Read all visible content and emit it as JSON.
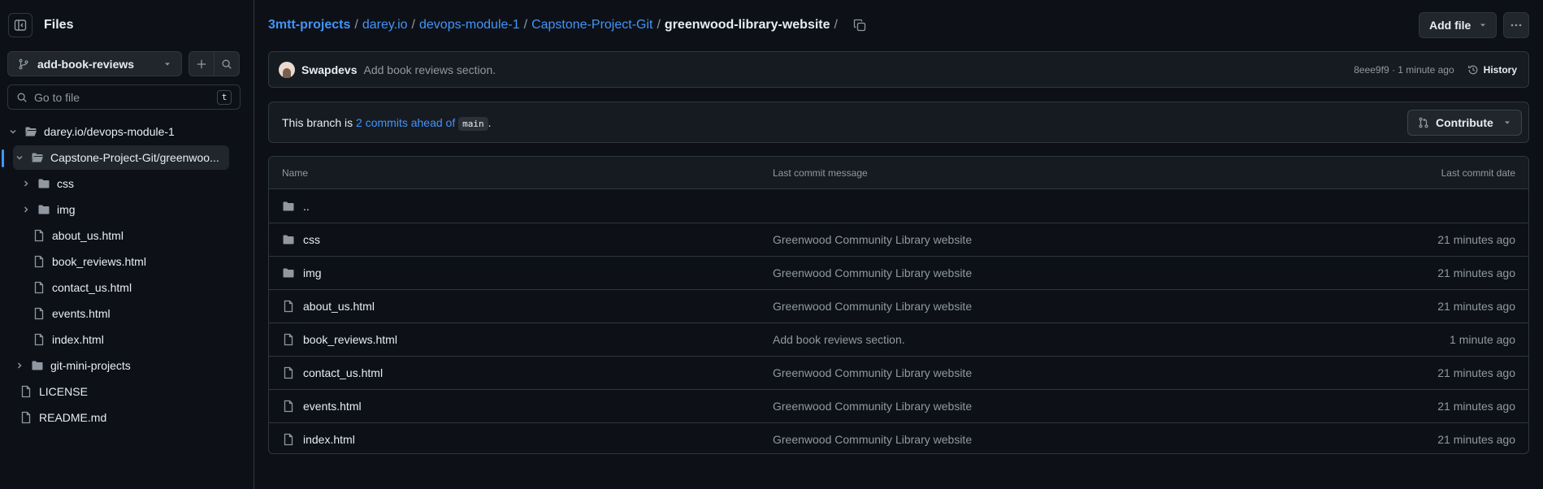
{
  "sidebar": {
    "title": "Files",
    "branch": "add-book-reviews",
    "search_placeholder": "Go to file",
    "search_shortcut": "t",
    "tree": [
      {
        "label": "darey.io/devops-module-1",
        "type": "folder-open",
        "expanded": true,
        "depth": 0
      },
      {
        "label": "Capstone-Project-Git/greenwoo...",
        "type": "folder-open",
        "expanded": true,
        "depth": 1,
        "selected": true
      },
      {
        "label": "css",
        "type": "folder",
        "expanded": false,
        "depth": 2
      },
      {
        "label": "img",
        "type": "folder",
        "expanded": false,
        "depth": 2
      },
      {
        "label": "about_us.html",
        "type": "file",
        "depth": 2
      },
      {
        "label": "book_reviews.html",
        "type": "file",
        "depth": 2
      },
      {
        "label": "contact_us.html",
        "type": "file",
        "depth": 2
      },
      {
        "label": "events.html",
        "type": "file",
        "depth": 2
      },
      {
        "label": "index.html",
        "type": "file",
        "depth": 2
      },
      {
        "label": "git-mini-projects",
        "type": "folder",
        "expanded": false,
        "depth": 1
      },
      {
        "label": "LICENSE",
        "type": "file",
        "depth": 0
      },
      {
        "label": "README.md",
        "type": "file",
        "depth": 0
      }
    ]
  },
  "breadcrumb": {
    "items": [
      "3mtt-projects",
      "darey.io",
      "devops-module-1",
      "Capstone-Project-Git"
    ],
    "current": "greenwood-library-website",
    "trailing_sep": "/"
  },
  "toolbar": {
    "add_file_label": "Add file"
  },
  "commit": {
    "author": "Swapdevs",
    "message": "Add book reviews section.",
    "meta": "8eee9f9 · 1 minute ago",
    "history_label": "History"
  },
  "branch_status": {
    "prefix": "This branch is",
    "link": "2 commits ahead of",
    "base": "main",
    "suffix": ".",
    "contribute_label": "Contribute"
  },
  "table": {
    "headers": [
      "Name",
      "Last commit message",
      "Last commit date"
    ],
    "parent_label": "..",
    "rows": [
      {
        "name": "css",
        "type": "folder",
        "message": "Greenwood Community Library website",
        "date": "21 minutes ago"
      },
      {
        "name": "img",
        "type": "folder",
        "message": "Greenwood Community Library website",
        "date": "21 minutes ago"
      },
      {
        "name": "about_us.html",
        "type": "file",
        "message": "Greenwood Community Library website",
        "date": "21 minutes ago"
      },
      {
        "name": "book_reviews.html",
        "type": "file",
        "message": "Add book reviews section.",
        "date": "1 minute ago"
      },
      {
        "name": "contact_us.html",
        "type": "file",
        "message": "Greenwood Community Library website",
        "date": "21 minutes ago"
      },
      {
        "name": "events.html",
        "type": "file",
        "message": "Greenwood Community Library website",
        "date": "21 minutes ago"
      },
      {
        "name": "index.html",
        "type": "file",
        "message": "Greenwood Community Library website",
        "date": "21 minutes ago"
      }
    ]
  },
  "colors": {
    "background": "#0d1117",
    "surface": "#161b22",
    "border": "#30363d",
    "link": "#4493f8",
    "text": "#e6edf3",
    "muted": "#9198a1"
  }
}
